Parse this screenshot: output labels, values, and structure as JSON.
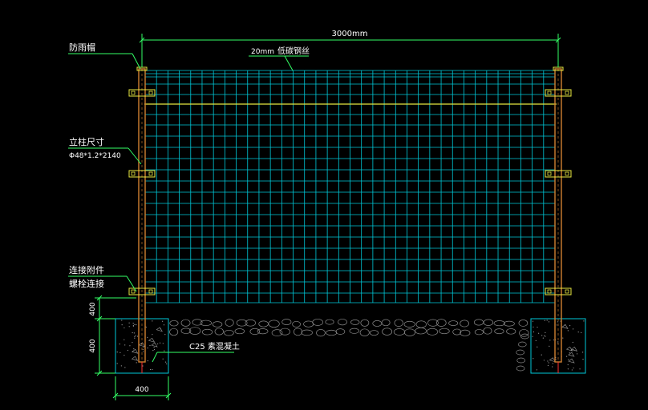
{
  "drawing": {
    "overall_width": "3000mm",
    "mesh_spec_size": "20mm",
    "mesh_spec_material": "低碳钢丝",
    "rain_cap_label": "防雨帽",
    "post_size_label": "立柱尺寸",
    "post_size_value": "Φ48*1.2*2140",
    "connector_label_1": "连接附件",
    "connector_label_2": "螺栓连接",
    "concrete_label": "C25 素混凝土",
    "dim_above_ground": "400",
    "dim_footing_depth": "400",
    "dim_footing_width": "400"
  },
  "colors": {
    "mesh": "#00c8d8",
    "rail": "#e8e840",
    "post": "#d08030",
    "dimension": "#33ff66",
    "footing": "#00c8d8",
    "text": "#ffffff"
  }
}
